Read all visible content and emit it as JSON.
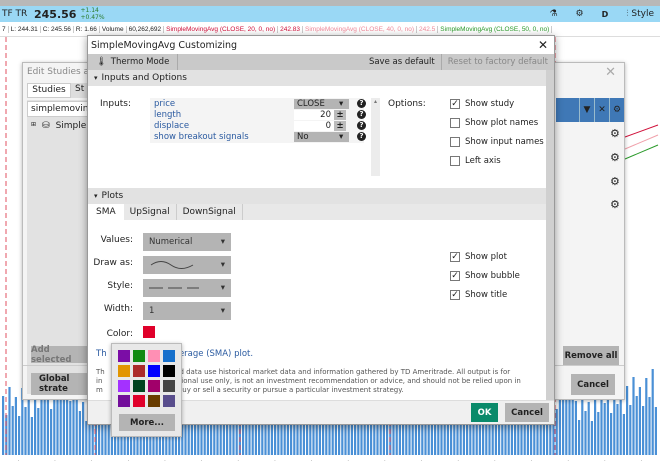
{
  "quote": {
    "symbol": "TF TR",
    "price": "245.56",
    "change": "+1.14",
    "change_pct": "+0.47%",
    "period": "D",
    "style_label": "Style"
  },
  "info": [
    "7",
    "L: 244.31",
    "C: 245.56",
    "R: 1.66",
    "Volume",
    "60,262,692",
    "SimpleMovingAvg (CLOSE, 20, 0, no)",
    "242.83",
    "SimpleMovingAvg (CLOSE, 40, 0, no)",
    "242.5",
    "SimpleMovingAvg (CLOSE, 50, 0, no)"
  ],
  "info_colors": [
    "#222",
    "#222",
    "#222",
    "#222",
    "#222",
    "#222",
    "#d0103a",
    "#d0103a",
    "#f08a9a",
    "#f08a9a",
    "#2a9a2a"
  ],
  "back_dialog": {
    "title": "Edit Studies and S",
    "tabs": [
      "Studies",
      "St"
    ],
    "search_value": "simplemovingav",
    "list_item": "SimpleM",
    "add_selected": "Add selected",
    "global_strategy": "Global strate",
    "remove_all": "Remove all",
    "cancel": "Cancel"
  },
  "dialog": {
    "title": "SimpleMovingAvg Customizing",
    "thermo": "Thermo Mode",
    "save_default": "Save as default",
    "reset_default": "Reset to factory default",
    "inputs_section": "Inputs and Options",
    "inputs_label": "Inputs:",
    "options_label": "Options:",
    "inputs": [
      {
        "name": "price",
        "value": "CLOSE",
        "type": "select"
      },
      {
        "name": "length",
        "value": "20",
        "type": "stepper"
      },
      {
        "name": "displace",
        "value": "0",
        "type": "stepper"
      },
      {
        "name": "show breakout signals",
        "value": "No",
        "type": "select"
      }
    ],
    "options": [
      {
        "label": "Show study",
        "checked": true
      },
      {
        "label": "Show plot names",
        "checked": false
      },
      {
        "label": "Show input names",
        "checked": false
      },
      {
        "label": "Left axis",
        "checked": false
      }
    ],
    "plots_section": "Plots",
    "plot_tabs": [
      "SMA",
      "UpSignal",
      "DownSignal"
    ],
    "plot_fields": {
      "values_label": "Values:",
      "values": "Numerical",
      "draw_label": "Draw as:",
      "style_label": "Style:",
      "width_label": "Width:",
      "width": "1",
      "color_label": "Color:",
      "color": "#e0002a"
    },
    "plot_options": [
      {
        "label": "Show plot",
        "checked": true
      },
      {
        "label": "Show bubble",
        "checked": true
      },
      {
        "label": "Show title",
        "checked": true
      }
    ],
    "desc1_pre": "Th",
    "desc1": "Average (SMA) plot.",
    "desc2_a": "Th",
    "desc2_b": "and data use historical market data and information gathered by TD Ameritrade. All output is for",
    "desc2_c": "in",
    "desc2_d": "cational use only, is not an investment recommendation or advice, and should not be relied upon in",
    "desc2_e": "m",
    "desc2_f": "buy or sell a security or pursue a particular investment strategy.",
    "ok": "OK",
    "cancel": "Cancel"
  },
  "palette": {
    "colors": [
      "#7b0da6",
      "#138a13",
      "#ff8fb4",
      "#1670cc",
      "#e29500",
      "#ac2b2b",
      "#0000ff",
      "#000000",
      "#a431ff",
      "#00441f",
      "#a1006a",
      "#444444",
      "#720d9a",
      "#e0002a",
      "#683c00",
      "#584d8c"
    ],
    "more": "More..."
  }
}
